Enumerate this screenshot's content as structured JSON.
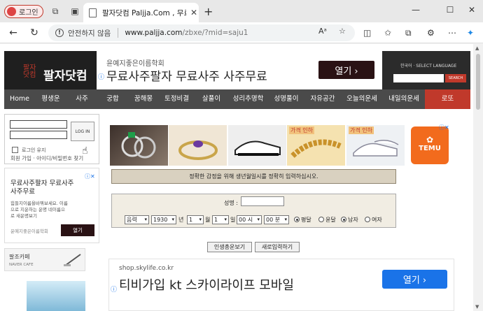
{
  "browser": {
    "profile_label": "로그인",
    "tab_title": "팔자닷컴 Paljja.Com , 무료운세, 무료",
    "security_text": "안전하지 않음",
    "url_host": "www.paljja.com",
    "url_path": "/zbxe/?mid=saju1"
  },
  "header": {
    "logo_small": "팔자\n닷컴",
    "logo_text": "팔자닷컴",
    "lang_text": "한국어 · SELECT LANGUAGE",
    "search_button": "SEARCH"
  },
  "top_ad": {
    "source": "윤예지좋은이름학회",
    "title": "무료사주팔자 무료사주 사주무료",
    "button": "열기 ›"
  },
  "menu": [
    {
      "label": "Home",
      "w": 44
    },
    {
      "label": "평생운",
      "w": 45
    },
    {
      "label": "사주",
      "w": 44
    },
    {
      "label": "궁합",
      "w": 44
    },
    {
      "label": "꿈해몽",
      "w": 44
    },
    {
      "label": "토정비결",
      "w": 51
    },
    {
      "label": "살풀이",
      "w": 48
    },
    {
      "label": "성리추명학",
      "w": 57
    },
    {
      "label": "성명풀이",
      "w": 52
    },
    {
      "label": "자유공간",
      "w": 52
    },
    {
      "label": "오늘의운세",
      "w": 60
    },
    {
      "label": "내일의운세",
      "w": 60
    },
    {
      "label": "로또",
      "w": 65
    }
  ],
  "login": {
    "button": "LOG IN",
    "remember": "로그인 유지",
    "links": "회원 가입 · 아이디/비밀번호 찾기"
  },
  "side_ad": {
    "title": "무료사주팔자 무료사주 사주무료",
    "desc": "힘들지이름을바꿔보세요. 이름으로 지운하는 운명 네이름으로 새운명보기",
    "source": "윤예지좋은이름학회",
    "button": "열기"
  },
  "cafe": {
    "title": "팔조카페",
    "subtitle": "NAVER CAFE"
  },
  "banner": {
    "tag1": "가격 인하",
    "tag2": "가격 인하",
    "temu": "TEMU"
  },
  "notice": "정확한 감정을 위해 생년월일시를 정확히 입력하십시오.",
  "form": {
    "name_label": "성명 :",
    "calendar": "음력",
    "year": "1930",
    "year_suffix": "년",
    "month": "1",
    "month_suffix": "월",
    "day": "1",
    "day_suffix": "일",
    "hour": "00 시",
    "minute": "00 분",
    "leap_normal": "평달",
    "leap": "윤달",
    "male": "남자",
    "female": "여자"
  },
  "actions": {
    "submit": "인생총운보기",
    "reset": "새로입력하기"
  },
  "bottom_ad": {
    "source": "shop.skylife.co.kr",
    "title": "티비가입 kt 스카이라이프 모바일",
    "button": "열기 ›"
  }
}
